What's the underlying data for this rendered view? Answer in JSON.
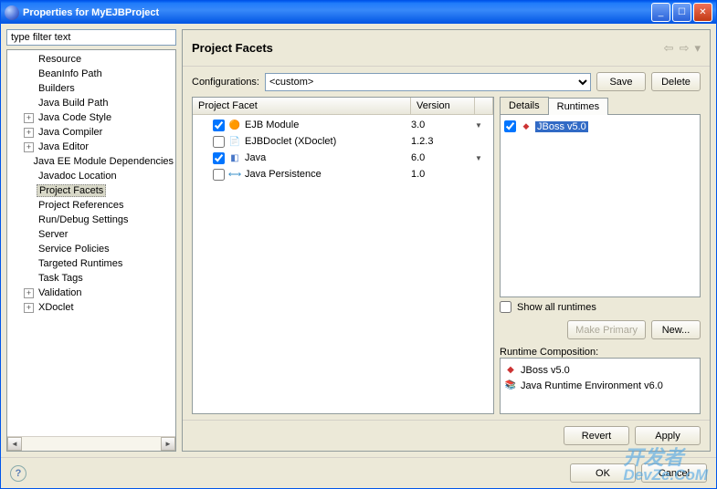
{
  "window": {
    "title": "Properties for MyEJBProject"
  },
  "filter": {
    "placeholder": "type filter text"
  },
  "tree": [
    {
      "label": "Resource",
      "expand": ""
    },
    {
      "label": "BeanInfo Path",
      "expand": ""
    },
    {
      "label": "Builders",
      "expand": ""
    },
    {
      "label": "Java Build Path",
      "expand": ""
    },
    {
      "label": "Java Code Style",
      "expand": "+"
    },
    {
      "label": "Java Compiler",
      "expand": "+"
    },
    {
      "label": "Java Editor",
      "expand": "+"
    },
    {
      "label": "Java EE Module Dependencies",
      "expand": ""
    },
    {
      "label": "Javadoc Location",
      "expand": ""
    },
    {
      "label": "Project Facets",
      "expand": "",
      "selected": true
    },
    {
      "label": "Project References",
      "expand": ""
    },
    {
      "label": "Run/Debug Settings",
      "expand": ""
    },
    {
      "label": "Server",
      "expand": ""
    },
    {
      "label": "Service Policies",
      "expand": ""
    },
    {
      "label": "Targeted Runtimes",
      "expand": ""
    },
    {
      "label": "Task Tags",
      "expand": ""
    },
    {
      "label": "Validation",
      "expand": "+"
    },
    {
      "label": "XDoclet",
      "expand": "+"
    }
  ],
  "page": {
    "title": "Project Facets",
    "config_label": "Configurations:",
    "config_value": "<custom>",
    "save": "Save",
    "delete": "Delete"
  },
  "facet_table": {
    "col_facet": "Project Facet",
    "col_version": "Version",
    "rows": [
      {
        "checked": true,
        "icon": "bean",
        "name": "EJB Module",
        "version": "3.0",
        "dd": true
      },
      {
        "checked": false,
        "icon": "doc",
        "name": "EJBDoclet (XDoclet)",
        "version": "1.2.3",
        "dd": false
      },
      {
        "checked": true,
        "icon": "java",
        "name": "Java",
        "version": "6.0",
        "dd": true
      },
      {
        "checked": false,
        "icon": "db",
        "name": "Java Persistence",
        "version": "1.0",
        "dd": false
      }
    ]
  },
  "tabs": {
    "details": "Details",
    "runtimes": "Runtimes"
  },
  "runtimes": {
    "items": [
      {
        "checked": true,
        "name": "JBoss v5.0"
      }
    ],
    "show_all": "Show all runtimes",
    "make_primary": "Make Primary",
    "new": "New...",
    "comp_label": "Runtime Composition:",
    "comp": [
      {
        "icon": "jb",
        "name": "JBoss v5.0"
      },
      {
        "icon": "jre",
        "name": "Java Runtime Environment v6.0"
      }
    ]
  },
  "footer": {
    "revert": "Revert",
    "apply": "Apply",
    "ok": "OK",
    "cancel": "Cancel"
  },
  "watermark": {
    "l1": "开发者",
    "l2": "DevZe.CoM"
  }
}
